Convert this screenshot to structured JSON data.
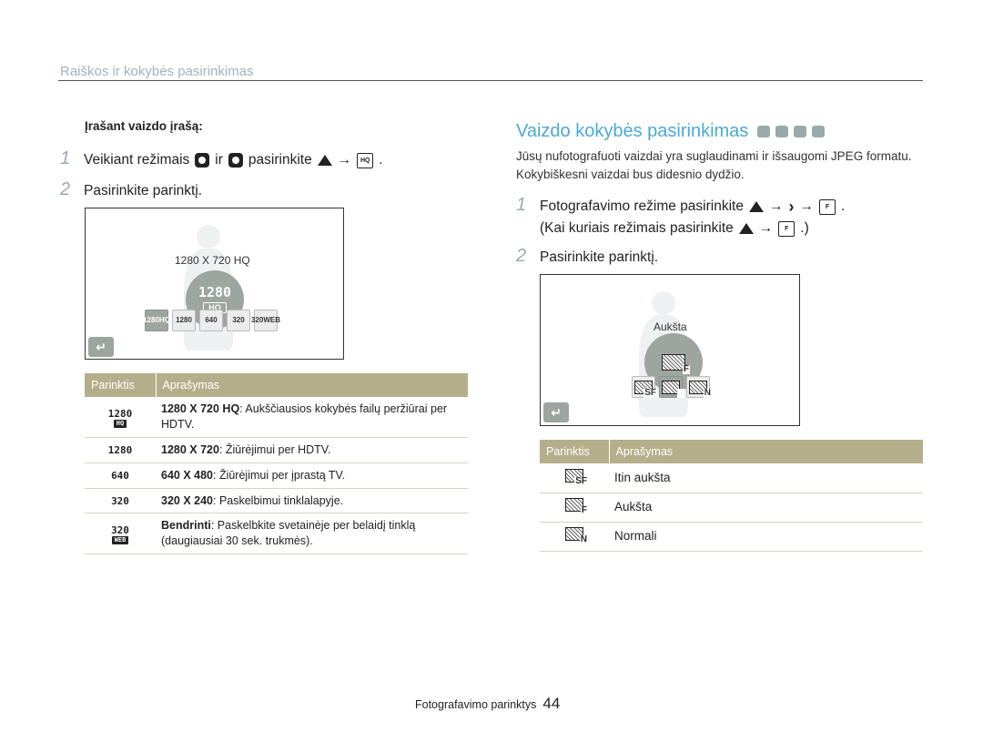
{
  "header": {
    "section_title": "Raiškos ir kokybės pasirinkimas"
  },
  "left": {
    "subheading": "Įrašant vaizdo įrašą:",
    "steps": [
      {
        "num": "1",
        "text_a": "Veikiant režimais",
        "text_b": "ir",
        "text_c": "pasirinkite",
        "arrow": "→",
        "end": "."
      },
      {
        "num": "2",
        "text": "Pasirinkite parinktį."
      }
    ],
    "screen": {
      "caption": "1280 X 720 HQ",
      "big_label": "1280",
      "big_sub": "HQ",
      "options": [
        {
          "top": "1280",
          "bottom": "HQ"
        },
        {
          "top": "1280",
          "bottom": ""
        },
        {
          "top": "640",
          "bottom": ""
        },
        {
          "top": "320",
          "bottom": ""
        },
        {
          "top": "320",
          "bottom": "WEB"
        }
      ],
      "back_icon": "↵"
    },
    "table": {
      "headers": [
        "Parinktis",
        "Aprašymas"
      ],
      "rows": [
        {
          "icon_top": "1280",
          "icon_bottom": "HQ",
          "bold": "1280 X 720 HQ",
          "rest": ": Aukščiausios kokybės failų peržiūrai per HDTV."
        },
        {
          "icon_top": "1280",
          "icon_bottom": "",
          "bold": "1280 X 720",
          "rest": ": Žiūrėjimui per HDTV."
        },
        {
          "icon_top": "640",
          "icon_bottom": "",
          "bold": "640 X 480",
          "rest": ": Žiūrėjimui per įprastą TV."
        },
        {
          "icon_top": "320",
          "icon_bottom": "",
          "bold": "320 X 240",
          "rest": ": Paskelbimui tinklalapyje."
        },
        {
          "icon_top": "320",
          "icon_bottom": "WEB",
          "bold": "Bendrinti",
          "rest": ": Paskelbkite svetainėje per belaidį tinklą (daugiausiai 30 sek. trukmės)."
        }
      ]
    }
  },
  "right": {
    "title": "Vaizdo kokybės pasirinkimas",
    "intro": "Jūsų nufotografuoti vaizdai yra suglaudinami ir išsaugomi JPEG formatu. Kokybiškesni vaizdai bus didesnio dydžio.",
    "steps": [
      {
        "num": "1",
        "line1_a": "Fotografavimo režime pasirinkite",
        "arrow": "→",
        "end": ".",
        "line2_a": "(Kai kuriais režimais pasirinkite",
        "line2_end": ".)"
      },
      {
        "num": "2",
        "text": "Pasirinkite parinktį."
      }
    ],
    "screen": {
      "caption": "Aukšta",
      "big_sub": "F",
      "options": [
        "SF",
        "F",
        "N"
      ],
      "back_icon": "↵"
    },
    "table": {
      "headers": [
        "Parinktis",
        "Aprašymas"
      ],
      "rows": [
        {
          "icon": "SF",
          "label": "Itin aukšta"
        },
        {
          "icon": "F",
          "label": "Aukšta"
        },
        {
          "icon": "N",
          "label": "Normali"
        }
      ]
    }
  },
  "footer": {
    "text": "Fotografavimo parinktys",
    "page": "44"
  }
}
